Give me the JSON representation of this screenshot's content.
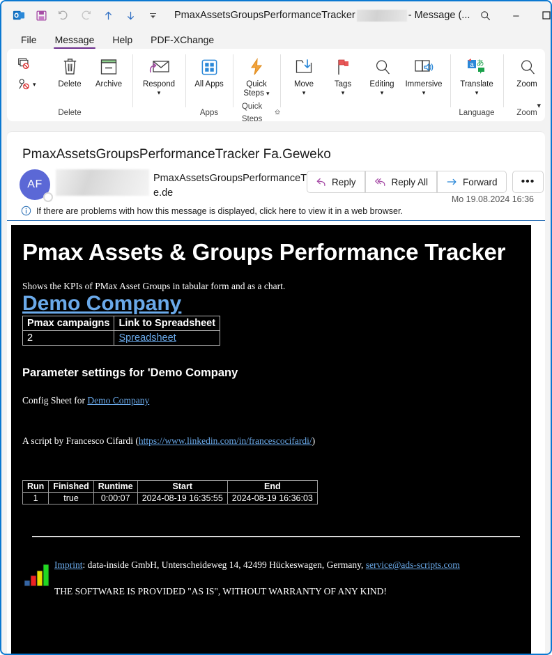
{
  "window": {
    "title_prefix": "PmaxAssetsGroupsPerformanceTracker",
    "title_suffix": "- Message (...",
    "redacted_label": "",
    "search_icon": "search-icon",
    "minimize": "–",
    "maximize": "☐",
    "close": "✕"
  },
  "quick_access": [
    {
      "name": "outlook-app-icon",
      "label": "O"
    },
    {
      "name": "save-icon",
      "label": ""
    },
    {
      "name": "undo-icon",
      "label": ""
    },
    {
      "name": "redo-icon",
      "label": ""
    },
    {
      "name": "previous-item-icon",
      "label": ""
    },
    {
      "name": "next-item-icon",
      "label": ""
    },
    {
      "name": "customize-qat-icon",
      "label": ""
    }
  ],
  "tabs": [
    {
      "label": "File",
      "active": false
    },
    {
      "label": "Message",
      "active": true
    },
    {
      "label": "Help",
      "active": false
    },
    {
      "label": "PDF-XChange",
      "active": false
    }
  ],
  "ribbon": {
    "groups": [
      {
        "label": "Delete",
        "small_buttons": [
          {
            "label": "",
            "icon": "ignore-icon"
          },
          {
            "label": "",
            "icon": "block-sender-icon"
          }
        ],
        "buttons": [
          {
            "label": "Delete",
            "icon": "trash-icon",
            "chevron": false
          },
          {
            "label": "Archive",
            "icon": "archive-icon",
            "chevron": false
          }
        ]
      },
      {
        "label": "",
        "buttons": [
          {
            "label": "Respond",
            "icon": "respond-icon",
            "chevron": true
          }
        ]
      },
      {
        "label": "Apps",
        "buttons": [
          {
            "label": "All Apps",
            "icon": "all-apps-icon",
            "chevron": false
          }
        ]
      },
      {
        "label": "Quick Steps",
        "launcher": true,
        "buttons": [
          {
            "label": "Quick Steps",
            "icon": "quick-steps-icon",
            "chevron": true,
            "inline_chevron": true
          }
        ]
      },
      {
        "label": "",
        "buttons": [
          {
            "label": "Move",
            "icon": "move-icon",
            "chevron": true
          },
          {
            "label": "Tags",
            "icon": "tags-icon",
            "chevron": true
          },
          {
            "label": "Editing",
            "icon": "editing-icon",
            "chevron": true
          },
          {
            "label": "Immersive",
            "icon": "immersive-icon",
            "chevron": true
          }
        ]
      },
      {
        "label": "Language",
        "buttons": [
          {
            "label": "Translate",
            "icon": "translate-icon",
            "chevron": true
          }
        ]
      },
      {
        "label": "Zoom",
        "buttons": [
          {
            "label": "Zoom",
            "icon": "zoom-icon",
            "chevron": false
          }
        ]
      }
    ],
    "collapse_icon": "chevron-down-icon"
  },
  "message": {
    "subject": "PmaxAssetsGroupsPerformanceTracker Fa.Geweko",
    "avatar_initials": "AF",
    "sender_name": "PmaxAssetsGroupsPerformanceT",
    "sender_domain": "e.de",
    "timestamp": "Mo 19.08.2024 16:36",
    "actions": [
      {
        "label": "Reply",
        "icon": "reply-icon"
      },
      {
        "label": "Reply All",
        "icon": "reply-all-icon"
      },
      {
        "label": "Forward",
        "icon": "forward-icon"
      },
      {
        "label": "•••",
        "icon": "more-actions-icon"
      }
    ],
    "infobar": "If there are problems with how this message is displayed, click here to view it in a web browser.",
    "infobar_icon": "info-icon"
  },
  "body": {
    "heading": "Pmax Assets & Groups Performance Tracker",
    "intro": "Shows the KPIs of PMax Asset Groups in tabular form and as a chart.",
    "company_link": "Demo Company",
    "campaign_table": {
      "headers": [
        "Pmax campaigns",
        "Link to Spreadsheet"
      ],
      "rows": [
        {
          "campaigns": "2",
          "link": "Spreadsheet"
        }
      ]
    },
    "params_heading": "Parameter settings for 'Demo Company",
    "config_prefix": "Config Sheet for ",
    "config_link": "Demo Company",
    "script_prefix": "A script by Francesco Cifardi (",
    "script_link": "https://www.linkedin.com/in/francescocifardi/",
    "script_suffix": ")",
    "run_table": {
      "headers": [
        "Run",
        "Finished",
        "Runtime",
        "Start",
        "End"
      ],
      "rows": [
        [
          "1",
          "true",
          "0:00:07",
          "2024-08-19 16:35:55",
          "2024-08-19 16:36:03"
        ]
      ]
    },
    "footer": {
      "imprint_link": "Imprint",
      "imprint_text": ": data-inside GmbH, Unterscheideweg 14, 42499 Hückeswagen, Germany, ",
      "email_link": "service@ads-scripts.com",
      "warranty": "THE SOFTWARE IS PROVIDED \"AS IS\", WITHOUT WARRANTY OF ANY KIND!",
      "logo_icon": "bar-chart-logo-icon",
      "logo_colors": [
        "#3465a4",
        "#ee2222",
        "#e8dd00",
        "#21d821"
      ]
    }
  },
  "colors": {
    "accent_purple": "#6b2d8c",
    "link_blue": "#6aa9e9",
    "window_border": "#0a78d1",
    "avatar_bg": "#5b68d6",
    "body_bg": "#000000"
  }
}
